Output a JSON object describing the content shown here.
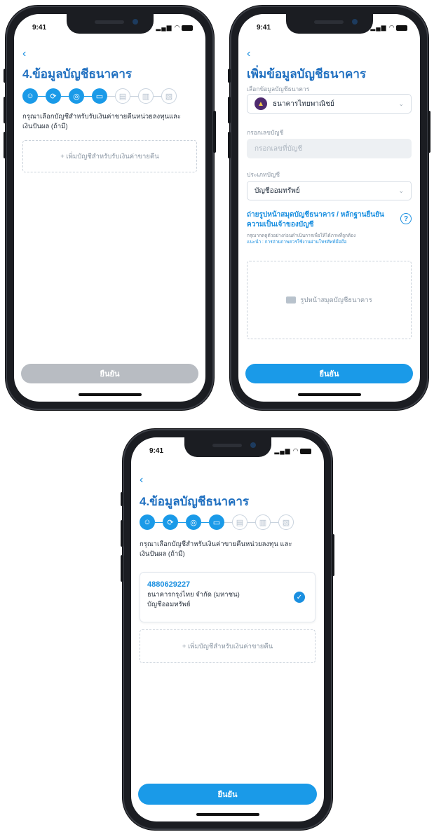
{
  "status": {
    "time": "9:41",
    "signal": "▂▄▆",
    "wifi": "◠"
  },
  "screen1": {
    "back": "‹",
    "title": "4.ข้อมูลบัญชีธนาคาร",
    "desc": "กรุณาเลือกบัญชีสำหรับรับเงินค่าขายคืนหน่วยลงทุนและ เงินปันผล (ถ้ามี)",
    "add_account": "+ เพิ่มบัญชีสำหรับรับเงินค่าขายคืน",
    "confirm": "ยืนยัน"
  },
  "screen2": {
    "back": "‹",
    "title": "เพิ่มข้อมูลบัญชีธนาคาร",
    "bank_label": "เลือกข้อมูลบัญชีธนาคาร",
    "bank_value": "ธนาคารไทยพาณิชย์",
    "account_label": "กรอกเลขบัญชี",
    "account_placeholder": "กรอกเลขที่บัญชี",
    "type_label": "ประเภทบัญชี",
    "type_value": "บัญชีออมทรัพย์",
    "photo_title": "ถ่ายรูปหน้าสมุดบัญชีธนาคาร / หลักฐานยืนยันความเป็นเจ้าของบัญชี",
    "help": "?",
    "photo_note": "กรุณากดดูตัวอย่างก่อนดำเนินการเพื่อให้ได้ภาพที่ถูกต้อง",
    "photo_link": "แนะนำ : การถ่ายภาพควรใช้งานผ่านโทรศัพท์มือถือ",
    "upload_label": "รูปหน้าสมุดบัญชีธนาคาร",
    "confirm": "ยืนยัน"
  },
  "screen3": {
    "back": "‹",
    "title": "4.ข้อมูลบัญชีธนาคาร",
    "desc": "กรุณาเลือกบัญชีสำหรับเงินค่าขายคืนหน่วยลงทุน และ เงินปันผล (ถ้ามี)",
    "account": {
      "number": "4880629227",
      "bank": "ธนาคารกรุงไทย จำกัด (มหาชน)",
      "type": "บัญชีออมทรัพย์",
      "check": "✓"
    },
    "add_account": "+ เพิ่มบัญชีสำหรับเงินค่าขายคืน",
    "confirm": "ยืนยัน"
  },
  "steps": {
    "icons": [
      "user-icon",
      "sync-icon",
      "shield-icon",
      "card-icon",
      "document-icon",
      "building-icon",
      "file-icon"
    ],
    "glyphs": [
      "☺",
      "⟳",
      "◎",
      "▭",
      "▤",
      "▥",
      "▧"
    ],
    "completed": 4,
    "total": 7
  },
  "colors": {
    "accent": "#1a9ae8",
    "title": "#1f6fc0",
    "disabled": "#b8bcc2",
    "frame": "#1b1d22"
  }
}
